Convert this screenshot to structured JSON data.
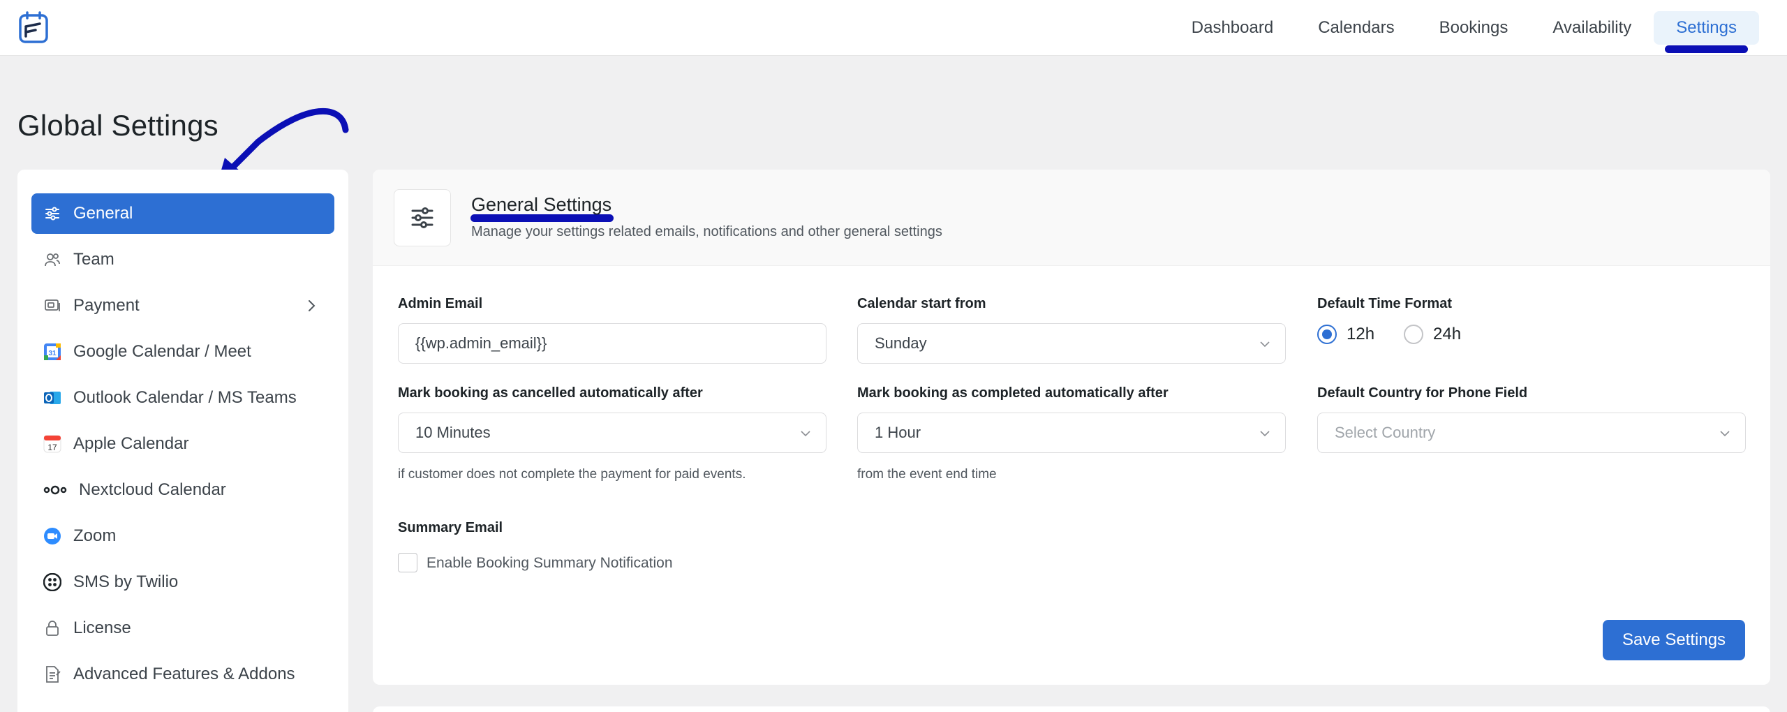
{
  "nav": {
    "items": [
      {
        "label": "Dashboard"
      },
      {
        "label": "Calendars"
      },
      {
        "label": "Bookings"
      },
      {
        "label": "Availability"
      },
      {
        "label": "Settings",
        "active": true
      }
    ]
  },
  "page": {
    "title": "Global Settings"
  },
  "sidebar": {
    "items": [
      {
        "label": "General",
        "icon": "sliders-icon",
        "active": true
      },
      {
        "label": "Team",
        "icon": "users-icon"
      },
      {
        "label": "Payment",
        "icon": "payment-icon",
        "has_submenu": true
      },
      {
        "label": "Google Calendar / Meet",
        "icon": "google-calendar-icon"
      },
      {
        "label": "Outlook Calendar / MS Teams",
        "icon": "outlook-icon"
      },
      {
        "label": "Apple Calendar",
        "icon": "apple-calendar-icon"
      },
      {
        "label": "Nextcloud Calendar",
        "icon": "nextcloud-icon"
      },
      {
        "label": "Zoom",
        "icon": "zoom-icon"
      },
      {
        "label": "SMS by Twilio",
        "icon": "twilio-icon"
      },
      {
        "label": "License",
        "icon": "lock-icon"
      },
      {
        "label": "Advanced Features & Addons",
        "icon": "addons-icon"
      }
    ]
  },
  "panel": {
    "title": "General Settings",
    "subtitle": "Manage your settings related emails, notifications and other general settings",
    "admin_email": {
      "label": "Admin Email",
      "value": "{{wp.admin_email}}"
    },
    "calendar_start": {
      "label": "Calendar start from",
      "value": "Sunday"
    },
    "time_format": {
      "label": "Default Time Format",
      "options": [
        "12h",
        "24h"
      ],
      "selected": "12h"
    },
    "cancel_after": {
      "label": "Mark booking as cancelled automatically after",
      "value": "10 Minutes",
      "hint": "if customer does not complete the payment for paid events."
    },
    "complete_after": {
      "label": "Mark booking as completed automatically after",
      "value": "1 Hour",
      "hint": "from the event end time"
    },
    "default_country": {
      "label": "Default Country for Phone Field",
      "placeholder": "Select Country"
    },
    "summary_email": {
      "label": "Summary Email",
      "checkbox_label": "Enable Booking Summary Notification",
      "checked": false
    },
    "save_label": "Save Settings"
  },
  "colors": {
    "primary": "#2d6fd3",
    "annotation": "#0b0fb5",
    "background": "#f0f0f1"
  }
}
